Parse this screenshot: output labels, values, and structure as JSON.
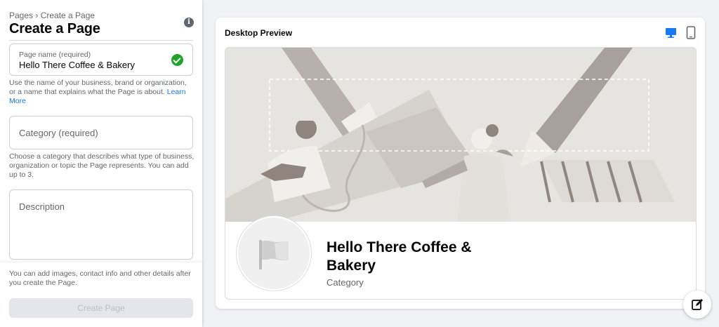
{
  "breadcrumb": "Pages › Create a Page",
  "title": "Create a Page",
  "page_name_field": {
    "label": "Page name (required)",
    "value": "Hello There Coffee & Bakery",
    "helper": "Use the name of your business, brand or organization, or a name that explains what the Page is about.",
    "learn_more": "Learn More"
  },
  "category_field": {
    "placeholder": "Category (required)",
    "helper": "Choose a category that describes what type of business, organization or topic the Page represents. You can add up to 3."
  },
  "description_field": {
    "placeholder": "Description"
  },
  "footer": {
    "note": "You can add images, contact info and other details after you create the Page.",
    "create_button": "Create Page"
  },
  "preview": {
    "title": "Desktop Preview",
    "page_name": "Hello There Coffee & Bakery",
    "category": "Category"
  },
  "icons": {
    "info": "info-icon",
    "check": "check-circle-icon",
    "desktop": "desktop-icon",
    "mobile": "mobile-icon",
    "flag": "flag-icon",
    "edit": "edit-icon"
  },
  "colors": {
    "accent": "#1877f2",
    "success": "#20a32a",
    "background": "#f0f2f5"
  }
}
